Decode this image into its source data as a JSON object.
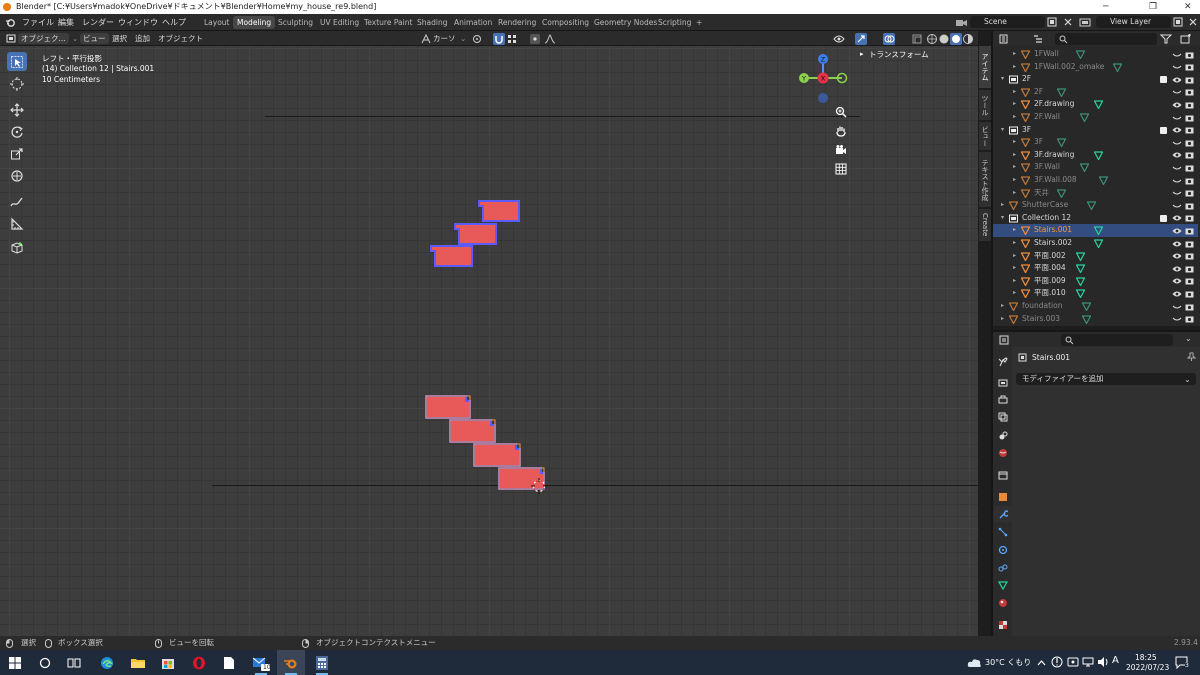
{
  "window": {
    "title": "Blender* [C:¥Users¥madok¥OneDrive¥ドキュメント¥Blender¥Home¥my_house_re9.blend]",
    "minimize": "─",
    "maximize": "❐",
    "close": "✕"
  },
  "menu": [
    "ファイル",
    "編集",
    "レンダー",
    "ウィンドウ",
    "ヘルプ"
  ],
  "workspaces": [
    {
      "label": "Layout",
      "active": false
    },
    {
      "label": "Modeling",
      "active": true
    },
    {
      "label": "Sculpting",
      "active": false
    },
    {
      "label": "UV Editing",
      "active": false
    },
    {
      "label": "Texture Paint",
      "active": false
    },
    {
      "label": "Shading",
      "active": false
    },
    {
      "label": "Animation",
      "active": false
    },
    {
      "label": "Rendering",
      "active": false
    },
    {
      "label": "Compositing",
      "active": false
    },
    {
      "label": "Geometry Nodes",
      "active": false
    },
    {
      "label": "Scripting",
      "active": false
    }
  ],
  "add_workspace": "+",
  "scene": {
    "label": "Scene"
  },
  "view_layer": {
    "label": "View Layer"
  },
  "viewport_header": {
    "mode": "オブジェク...",
    "view": "ビュー",
    "select": "選択",
    "add": "追加",
    "object": "オブジェクト",
    "pivot": "カーソ"
  },
  "overlay": {
    "line1": "レフト・平行投影",
    "line2": "(14) Collection 12 | Stairs.001",
    "line3": "10 Centimeters"
  },
  "gizmo": {
    "x": "X",
    "y": "Y",
    "z": "Z"
  },
  "n_panel": {
    "transform": "トランスフォーム"
  },
  "side_tabs": [
    "アイテム",
    "ツール",
    "ビュー",
    "テキスト作成",
    "Create"
  ],
  "colors": {
    "selected_orange": "#f79b3b",
    "mesh_face": "#e85a5a",
    "mesh_edge": "#5b5bff",
    "accent": "#4772b3",
    "mesh_icon": "#26d3a0",
    "object_icon": "#e88a3a"
  },
  "outliner": {
    "search_placeholder": "",
    "rows": [
      {
        "name": "1FWall",
        "type": "mesh",
        "depth": 2,
        "dim": true,
        "sel": false
      },
      {
        "name": "1FWall.002_omake",
        "type": "mesh",
        "depth": 2,
        "dim": true,
        "sel": false
      },
      {
        "name": "2F",
        "type": "collection",
        "depth": 1,
        "dim": false,
        "sel": false
      },
      {
        "name": "2F",
        "type": "mesh",
        "depth": 2,
        "dim": true,
        "sel": false
      },
      {
        "name": "2F.drawing",
        "type": "mesh",
        "depth": 2,
        "dim": false,
        "sel": false
      },
      {
        "name": "2F.Wall",
        "type": "mesh",
        "depth": 2,
        "dim": true,
        "sel": false
      },
      {
        "name": "3F",
        "type": "collection",
        "depth": 1,
        "dim": false,
        "sel": false
      },
      {
        "name": "3F",
        "type": "mesh",
        "depth": 2,
        "dim": true,
        "sel": false
      },
      {
        "name": "3F.drawing",
        "type": "mesh",
        "depth": 2,
        "dim": false,
        "sel": false
      },
      {
        "name": "3F.Wall",
        "type": "mesh",
        "depth": 2,
        "dim": true,
        "sel": false
      },
      {
        "name": "3F.Wall.008",
        "type": "mesh",
        "depth": 2,
        "dim": true,
        "sel": false
      },
      {
        "name": "天井",
        "type": "mesh",
        "depth": 2,
        "dim": true,
        "sel": false
      },
      {
        "name": "ShutterCase",
        "type": "mesh",
        "depth": 1,
        "dim": true,
        "sel": false
      },
      {
        "name": "Collection 12",
        "type": "collection",
        "depth": 1,
        "dim": false,
        "sel": false
      },
      {
        "name": "Stairs.001",
        "type": "mesh",
        "depth": 2,
        "dim": false,
        "sel": true
      },
      {
        "name": "Stairs.002",
        "type": "mesh",
        "depth": 2,
        "dim": false,
        "sel": false
      },
      {
        "name": "平面.002",
        "type": "mesh",
        "depth": 2,
        "dim": false,
        "sel": false
      },
      {
        "name": "平面.004",
        "type": "mesh",
        "depth": 2,
        "dim": false,
        "sel": false
      },
      {
        "name": "平面.009",
        "type": "mesh",
        "depth": 2,
        "dim": false,
        "sel": false
      },
      {
        "name": "平面.010",
        "type": "mesh",
        "depth": 2,
        "dim": false,
        "sel": false
      },
      {
        "name": "foundation",
        "type": "mesh",
        "depth": 1,
        "dim": true,
        "sel": false
      },
      {
        "name": "Stairs.003",
        "type": "mesh",
        "depth": 1,
        "dim": true,
        "sel": false
      }
    ]
  },
  "properties": {
    "object_name": "Stairs.001",
    "add_modifier": "モディファイアーを追加"
  },
  "statusbar": {
    "select": "選択",
    "box_select": "ボックス選択",
    "rotate_view": "ビューを回転",
    "context_menu": "オブジェクトコンテクストメニュー",
    "version": "2.93.4"
  },
  "taskbar": {
    "weather": "30°C くもり",
    "ime": "A",
    "time": "18:25",
    "date": "2022/07/23",
    "mail_badge": "10",
    "notif_badge": "3"
  }
}
